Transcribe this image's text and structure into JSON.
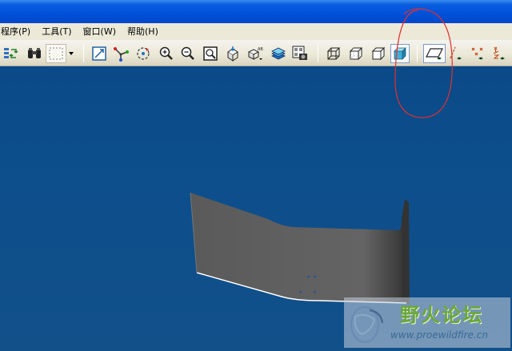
{
  "window": {
    "titlebar_color": "#0050d8"
  },
  "menu": {
    "items": [
      {
        "label": "程序(P)",
        "icon": ""
      },
      {
        "label": "工具(T)",
        "icon": ""
      },
      {
        "label": "窗口(W)",
        "icon": ""
      },
      {
        "label": "帮助(H)",
        "icon": ""
      }
    ]
  },
  "toolbar": {
    "buttons": [
      "regenerate-icon",
      "find-icon",
      "select-box-icon",
      "dropdown-arrow-icon",
      "repaint-icon",
      "spin-center-icon",
      "orient-mode-icon",
      "zoom-in-icon",
      "zoom-out-icon",
      "refit-icon",
      "reorient-icon",
      "saved-views-icon",
      "layers-icon",
      "view-manager-icon",
      "wireframe-icon",
      "hidden-line-icon",
      "no-hidden-icon",
      "shading-icon",
      "datum-planes-icon",
      "datum-axes-icon",
      "datum-points-icon",
      "coordinate-systems-icon"
    ],
    "pressed": [
      "shading-icon",
      "datum-planes-icon"
    ]
  },
  "viewport": {
    "background_top": "#0a4a88",
    "background_bottom": "#12508a",
    "model_fill": "#5f5f5f",
    "model_edge": "#ffffff"
  },
  "annotation": {
    "color": "#e03030",
    "shape": "hand-drawn-circle"
  },
  "watermark": {
    "title": "野火论坛",
    "url": "www.proewildfire.cn",
    "title_color": "#6aa838"
  }
}
